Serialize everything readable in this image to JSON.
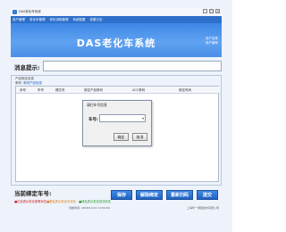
{
  "window": {
    "title": "DAS老化车系统"
  },
  "menu": [
    "用户管理",
    "老化车管理",
    "老化流程管理",
    "系统配置",
    "查看日志"
  ],
  "banner": {
    "title": "DAS老化车系统",
    "user_line1": "用户名称",
    "user_line2": "用户编号"
  },
  "message": {
    "label": "消息提示:",
    "value": ""
  },
  "group": {
    "title": "产品绑定信息",
    "sub_label": "条码",
    "sub_link": "条码产品信息"
  },
  "table": {
    "columns": [
      "序号",
      "车号",
      "槽位号",
      "绑定产品条码",
      "ACC条码",
      "绑定时间"
    ],
    "rows": []
  },
  "dialog": {
    "title": "请扫车号信息",
    "car_label": "车号:",
    "car_value": "",
    "ok_label": "确定",
    "cancel_label": "取消"
  },
  "bottom": {
    "current_car_label": "当前绑定车号:",
    "legend": {
      "red": "■红色表示老化报警状态",
      "orange": "■橙色表示老化中状态",
      "green": "■绿色表示老化完成状态"
    },
    "buttons": {
      "save": "保存",
      "unbind": "解除绑定",
      "rescan": "重新扫码",
      "submit": "提交"
    },
    "status_text": "当前时间: 2018/11/12 11:50:09",
    "status_right": "上海华一测控技术有限公司"
  },
  "colors": {
    "banner": "#4a8fe8",
    "menubar": "#2e6fc9",
    "button": "#2f74d4",
    "legend_red": "#d02020",
    "legend_orange": "#e07a10",
    "legend_green": "#2f9a2f"
  }
}
